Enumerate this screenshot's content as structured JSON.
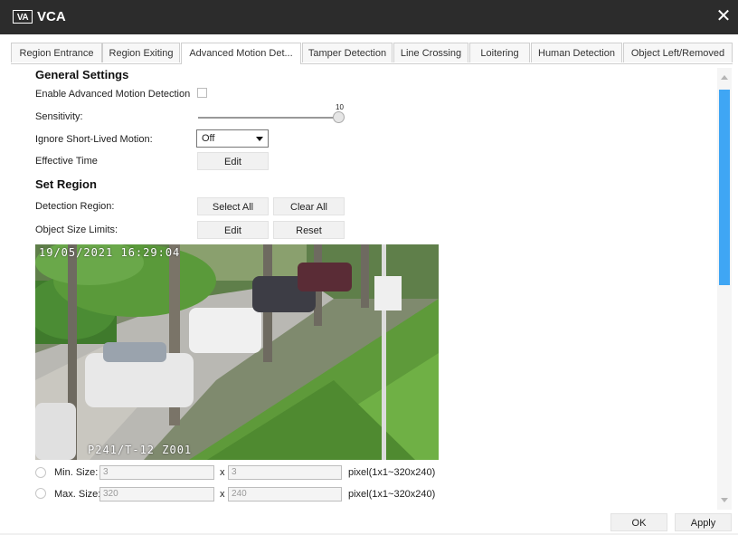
{
  "window": {
    "logo_text": "VA",
    "title": "VCA",
    "close_glyph": "✕"
  },
  "tabs": [
    {
      "label": "Region Entrance",
      "active": false
    },
    {
      "label": "Region Exiting",
      "active": false
    },
    {
      "label": "Advanced Motion Det...",
      "active": true
    },
    {
      "label": "Tamper Detection",
      "active": false
    },
    {
      "label": "Line Crossing",
      "active": false
    },
    {
      "label": "Loitering",
      "active": false
    },
    {
      "label": "Human Detection",
      "active": false
    },
    {
      "label": "Object Left/Removed",
      "active": false
    }
  ],
  "general": {
    "section_title": "General Settings",
    "enable_label": "Enable Advanced Motion Detection",
    "enable_checked": false,
    "sensitivity_label": "Sensitivity:",
    "sensitivity_value": "10",
    "sensitivity_fraction": 1.0,
    "ignore_label": "Ignore Short-Lived Motion:",
    "ignore_value": "Off",
    "effective_time_label": "Effective Time",
    "effective_time_button": "Edit"
  },
  "set_region": {
    "section_title": "Set Region",
    "detection_region_label": "Detection Region:",
    "select_all_button": "Select All",
    "clear_all_button": "Clear All",
    "object_size_label": "Object Size Limits:",
    "object_size_edit_button": "Edit",
    "object_size_reset_button": "Reset"
  },
  "preview": {
    "timestamp": "19/05/2021 16:29:04",
    "camera_label": "P241/T-12  Z001"
  },
  "size_limits": {
    "min_label": "Min. Size:",
    "min_width": "3",
    "min_height": "3",
    "max_label": "Max. Size:",
    "max_width": "320",
    "max_height": "240",
    "times": "x",
    "range_hint": "pixel(1x1~320x240)"
  },
  "footer": {
    "ok_button": "OK",
    "apply_button": "Apply"
  },
  "colors": {
    "titlebar": "#2c2c2c",
    "scroll_thumb": "#3fa6f4"
  }
}
